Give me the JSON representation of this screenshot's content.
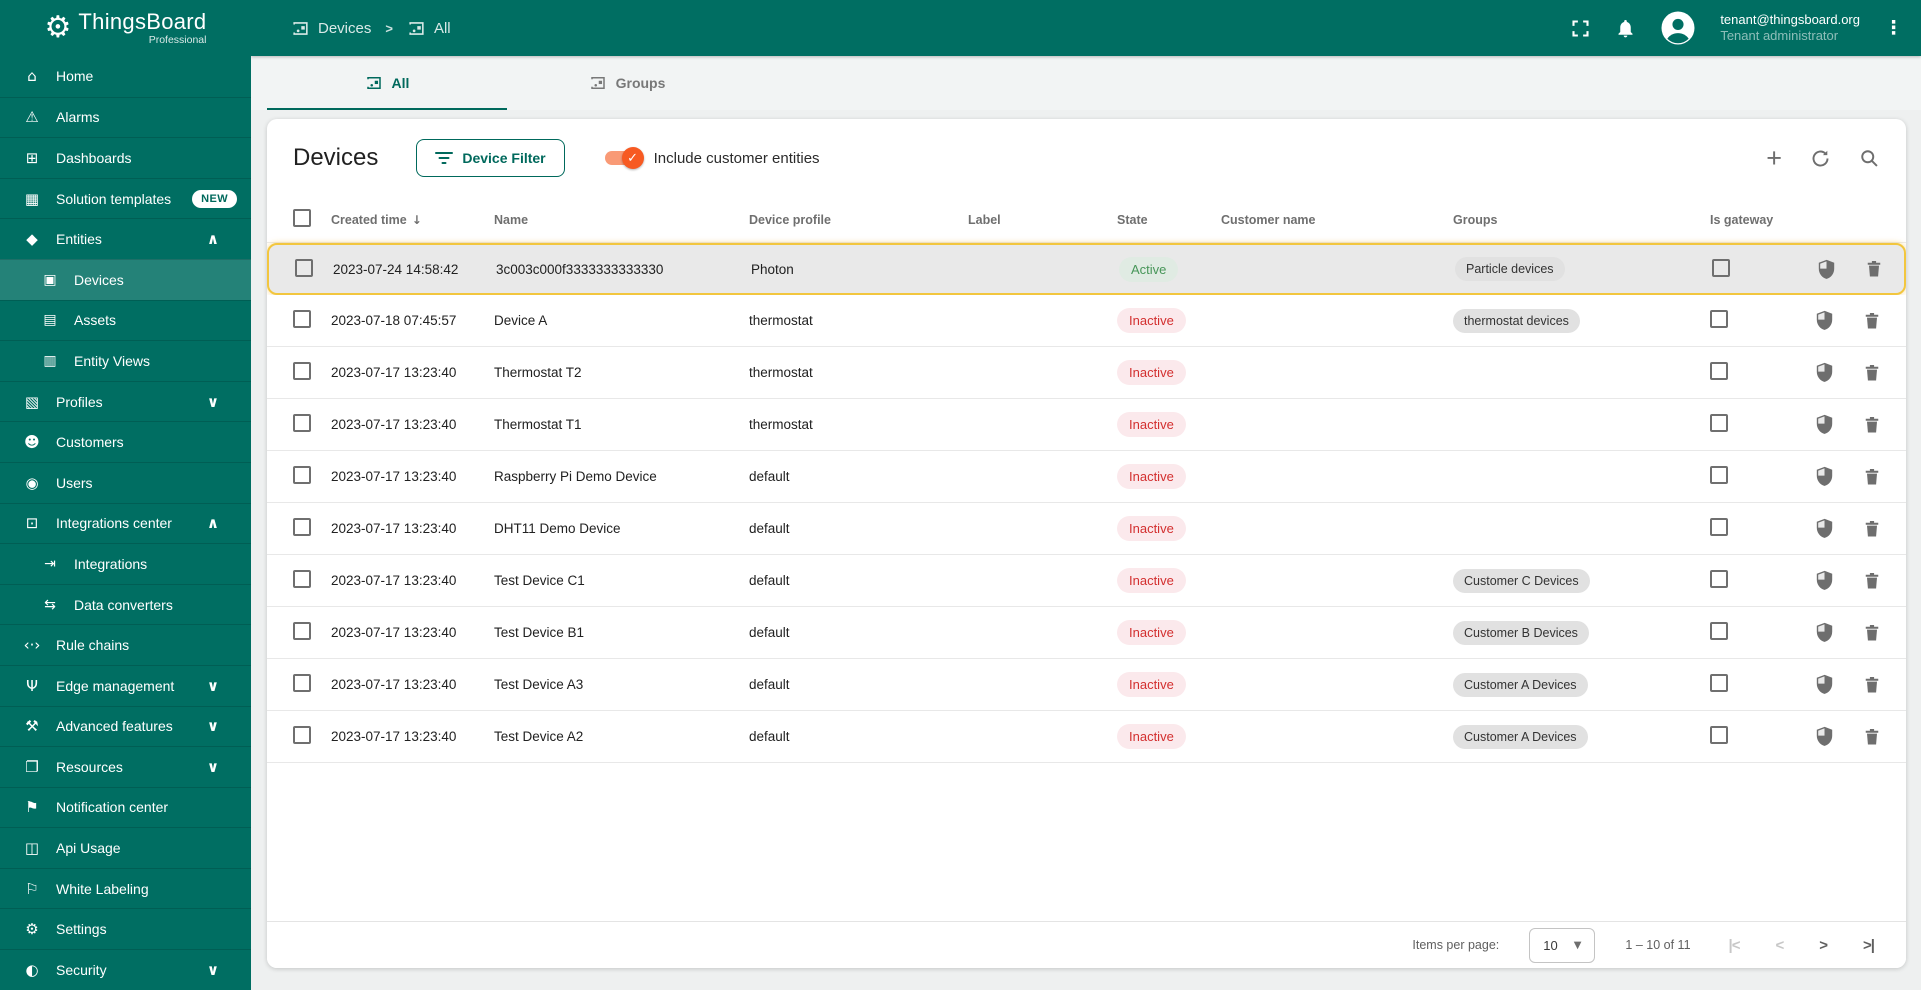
{
  "colors": {
    "primary_teal": "#006e62",
    "accent_orange": "#f75a22",
    "highlight_border": "#f2c63e",
    "active_green": "#479659",
    "inactive_red": "#d32f2f"
  },
  "sidebar": {
    "logo_title": "ThingsBoard",
    "logo_subtitle": "Professional",
    "items": [
      {
        "label": "Home",
        "icon": "home-icon",
        "glyph": "⌂"
      },
      {
        "label": "Alarms",
        "icon": "alarms-icon",
        "glyph": "⚠"
      },
      {
        "label": "Dashboards",
        "icon": "dashboards-icon",
        "glyph": "⊞"
      },
      {
        "label": "Solution templates",
        "icon": "solution-templates-icon",
        "glyph": "▦",
        "badge": "NEW"
      },
      {
        "label": "Entities",
        "icon": "entities-icon",
        "glyph": "◆",
        "chevron": "up"
      },
      {
        "label": "Devices",
        "icon": "devices-icon",
        "glyph": "▣",
        "sub": true,
        "selected": true
      },
      {
        "label": "Assets",
        "icon": "assets-icon",
        "glyph": "▤",
        "sub": true
      },
      {
        "label": "Entity Views",
        "icon": "entity-views-icon",
        "glyph": "▥",
        "sub": true
      },
      {
        "label": "Profiles",
        "icon": "profiles-icon",
        "glyph": "▧",
        "chevron": "down"
      },
      {
        "label": "Customers",
        "icon": "customers-icon",
        "glyph": "☻"
      },
      {
        "label": "Users",
        "icon": "users-icon",
        "glyph": "◉"
      },
      {
        "label": "Integrations center",
        "icon": "integrations-center-icon",
        "glyph": "⊡",
        "chevron": "up"
      },
      {
        "label": "Integrations",
        "icon": "integrations-icon",
        "glyph": "⇥",
        "sub": true
      },
      {
        "label": "Data converters",
        "icon": "data-converters-icon",
        "glyph": "⇆",
        "sub": true
      },
      {
        "label": "Rule chains",
        "icon": "rule-chains-icon",
        "glyph": "‹·›"
      },
      {
        "label": "Edge management",
        "icon": "edge-management-icon",
        "glyph": "Ψ",
        "chevron": "down"
      },
      {
        "label": "Advanced features",
        "icon": "advanced-features-icon",
        "glyph": "⚒",
        "chevron": "down"
      },
      {
        "label": "Resources",
        "icon": "resources-icon",
        "glyph": "❐",
        "chevron": "down"
      },
      {
        "label": "Notification center",
        "icon": "notification-center-icon",
        "glyph": "⚑"
      },
      {
        "label": "Api Usage",
        "icon": "api-usage-icon",
        "glyph": "◫"
      },
      {
        "label": "White Labeling",
        "icon": "white-labeling-icon",
        "glyph": "⚐"
      },
      {
        "label": "Settings",
        "icon": "settings-icon",
        "glyph": "⚙"
      },
      {
        "label": "Security",
        "icon": "security-icon",
        "glyph": "◐",
        "chevron": "down"
      }
    ]
  },
  "header": {
    "breadcrumb": [
      {
        "label": "Devices"
      },
      {
        "label": "All"
      }
    ],
    "separator": ">",
    "user_email": "tenant@thingsboard.org",
    "user_role": "Tenant administrator",
    "icons": [
      "fullscreen-icon",
      "notifications-bell-icon",
      "avatar-icon",
      "more-vertical-icon"
    ]
  },
  "tabs": [
    {
      "label": "All",
      "active": true
    },
    {
      "label": "Groups",
      "active": false
    }
  ],
  "toolbar": {
    "title": "Devices",
    "filter_button_label": "Device Filter",
    "toggle_label": "Include customer entities",
    "toggle_on": true,
    "icons": [
      "plus-icon",
      "refresh-icon",
      "search-icon"
    ]
  },
  "table": {
    "columns": [
      "Created time",
      "Name",
      "Device profile",
      "Label",
      "State",
      "Customer name",
      "Groups",
      "Is gateway"
    ],
    "sorted_column": "Created time",
    "sort_direction": "desc",
    "rows": [
      {
        "created": "2023-07-24 14:58:42",
        "name": "3c003c000f3333333333330",
        "profile": "Photon",
        "label": "",
        "state": "Active",
        "customer": "",
        "group": "Particle devices",
        "selected": true
      },
      {
        "created": "2023-07-18 07:45:57",
        "name": "Device A",
        "profile": "thermostat",
        "label": "",
        "state": "Inactive",
        "customer": "",
        "group": "thermostat devices"
      },
      {
        "created": "2023-07-17 13:23:40",
        "name": "Thermostat T2",
        "profile": "thermostat",
        "label": "",
        "state": "Inactive",
        "customer": "",
        "group": ""
      },
      {
        "created": "2023-07-17 13:23:40",
        "name": "Thermostat T1",
        "profile": "thermostat",
        "label": "",
        "state": "Inactive",
        "customer": "",
        "group": ""
      },
      {
        "created": "2023-07-17 13:23:40",
        "name": "Raspberry Pi Demo Device",
        "profile": "default",
        "label": "",
        "state": "Inactive",
        "customer": "",
        "group": ""
      },
      {
        "created": "2023-07-17 13:23:40",
        "name": "DHT11 Demo Device",
        "profile": "default",
        "label": "",
        "state": "Inactive",
        "customer": "",
        "group": ""
      },
      {
        "created": "2023-07-17 13:23:40",
        "name": "Test Device C1",
        "profile": "default",
        "label": "",
        "state": "Inactive",
        "customer": "",
        "group": "Customer C Devices"
      },
      {
        "created": "2023-07-17 13:23:40",
        "name": "Test Device B1",
        "profile": "default",
        "label": "",
        "state": "Inactive",
        "customer": "",
        "group": "Customer B Devices"
      },
      {
        "created": "2023-07-17 13:23:40",
        "name": "Test Device A3",
        "profile": "default",
        "label": "",
        "state": "Inactive",
        "customer": "",
        "group": "Customer A Devices"
      },
      {
        "created": "2023-07-17 13:23:40",
        "name": "Test Device A2",
        "profile": "default",
        "label": "",
        "state": "Inactive",
        "customer": "",
        "group": "Customer A Devices"
      }
    ]
  },
  "pagination": {
    "items_per_page_label": "Items per page:",
    "page_size": "10",
    "range": "1 – 10 of 11",
    "nav": {
      "first": "|<",
      "prev": "<",
      "next": ">",
      "last": ">|"
    }
  }
}
